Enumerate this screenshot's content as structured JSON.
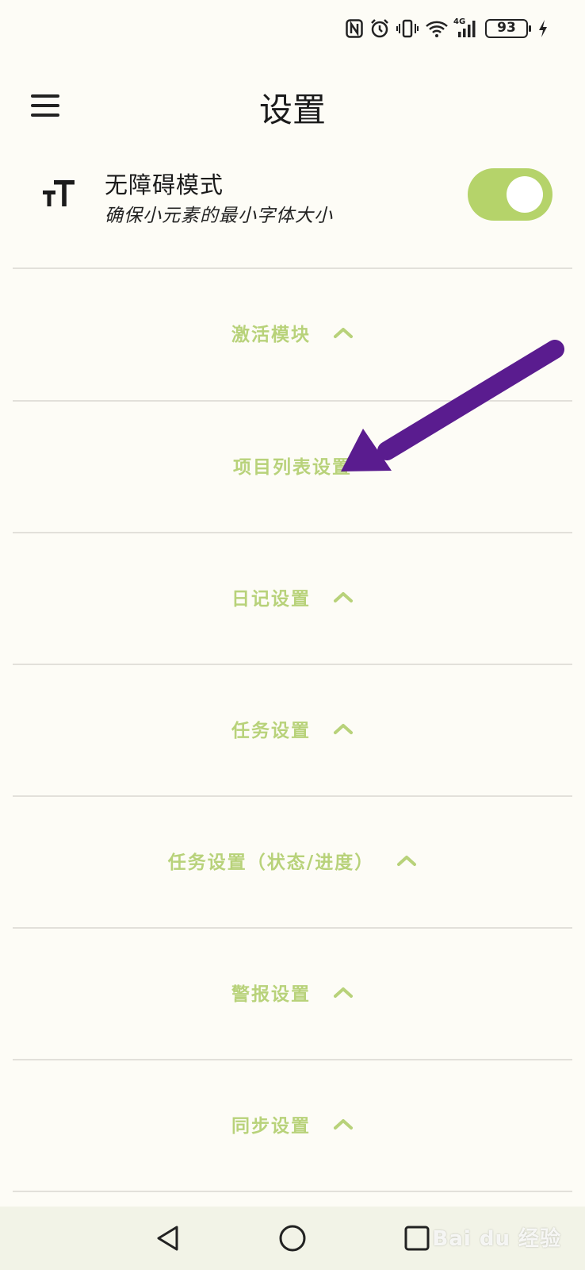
{
  "status_bar": {
    "battery_level": "93",
    "network": "4G",
    "icons": [
      "nfc-icon",
      "alarm-icon",
      "vibrate-icon",
      "wifi-icon",
      "signal-icon",
      "battery-icon",
      "charging-icon"
    ]
  },
  "header": {
    "title": "设置",
    "menu_icon": "hamburger-menu-icon"
  },
  "accessibility": {
    "icon": "text-size-icon",
    "title": "无障碍模式",
    "subtitle": "确保小元素的最小字体大小",
    "enabled": true
  },
  "sections": [
    {
      "label": "激活模块",
      "expanded": true
    },
    {
      "label": "项目列表设置",
      "expanded": false
    },
    {
      "label": "日记设置",
      "expanded": true
    },
    {
      "label": "任务设置",
      "expanded": true
    },
    {
      "label": "任务设置（状态/进度）",
      "expanded": true
    },
    {
      "label": "警报设置",
      "expanded": true
    },
    {
      "label": "同步设置",
      "expanded": true
    }
  ],
  "colors": {
    "background": "#fdfcf6",
    "accent": "#b5d36a",
    "section_text": "#b8d27a",
    "annotation_arrow": "#5a1c8f",
    "navbar": "#f2f3e7"
  },
  "nav": {
    "back_icon": "back-triangle-icon",
    "home_icon": "home-circle-icon",
    "recents_icon": "recents-square-icon"
  },
  "watermark": {
    "text": "Bai du 经验"
  }
}
